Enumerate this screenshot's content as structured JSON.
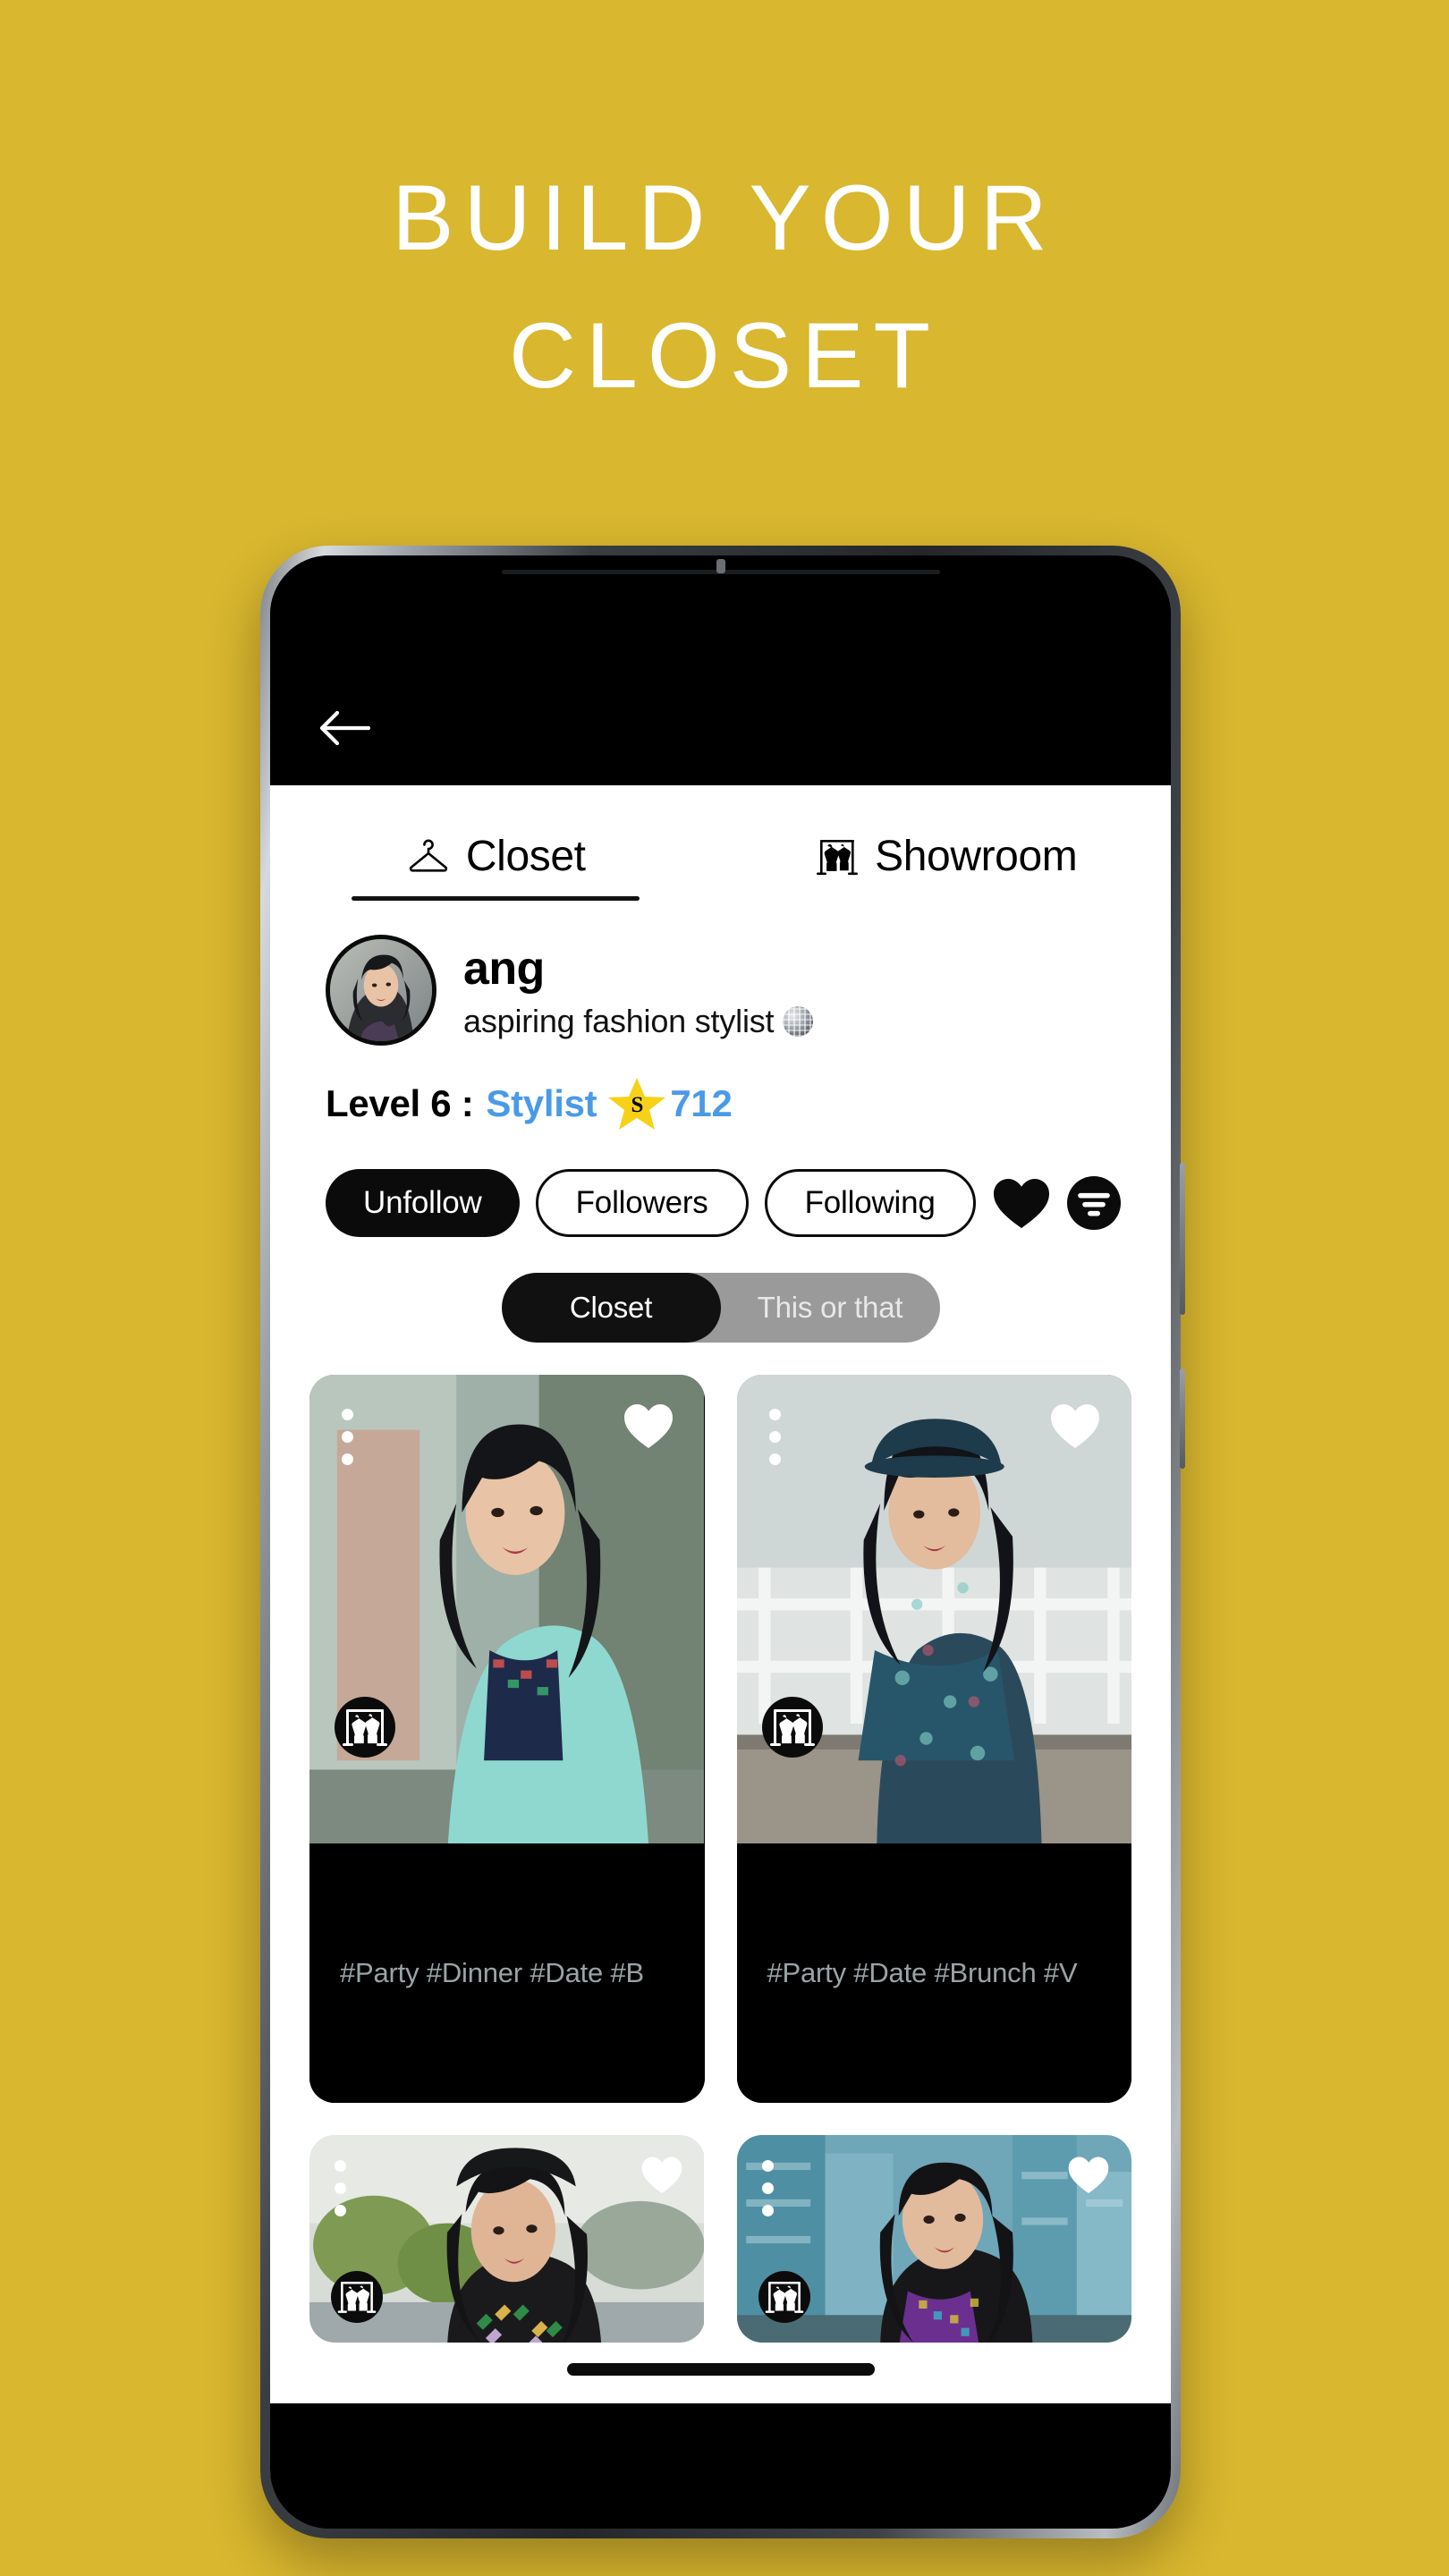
{
  "promo": {
    "headline_line1": "BUILD YOUR",
    "headline_line2": "CLOSET",
    "background_color": "#D9B72E",
    "text_color": "#FFFFFF"
  },
  "appbar": {
    "back_icon": "arrow-left-icon"
  },
  "tabs": [
    {
      "label": "Closet",
      "icon": "hanger-icon",
      "active": true
    },
    {
      "label": "Showroom",
      "icon": "clothing-rack-icon",
      "active": false
    }
  ],
  "profile": {
    "avatar": "user-avatar",
    "username": "ang",
    "bio": "aspiring fashion stylist",
    "bio_emoji": "disco-ball-emoji"
  },
  "level": {
    "prefix": "Level 6 :",
    "rank": "Stylist",
    "star_letter": "S",
    "points": "712",
    "rank_color": "#4A9AE8",
    "star_color": "#F7D117"
  },
  "actions": {
    "unfollow_label": "Unfollow",
    "followers_label": "Followers",
    "following_label": "Following",
    "heart_icon": "heart-filled-icon",
    "filter_icon": "filter-icon"
  },
  "segmented": {
    "option_closet": "Closet",
    "option_this_or_that": "This or that",
    "active": "Closet"
  },
  "cards": [
    {
      "photo": "outfit-mint-blazer",
      "hashtags": "#Party #Dinner #Date #B",
      "liked": true,
      "menu_icon": "more-options-icon",
      "showroom_icon": "clothing-rack-icon"
    },
    {
      "photo": "outfit-floral-dress",
      "hashtags": "#Party #Date #Brunch #V",
      "liked": true,
      "menu_icon": "more-options-icon",
      "showroom_icon": "clothing-rack-icon"
    },
    {
      "photo": "outfit-diamond-print-top",
      "liked": true,
      "menu_icon": "more-options-icon",
      "showroom_icon": "clothing-rack-icon"
    },
    {
      "photo": "outfit-purple-city",
      "liked": true,
      "menu_icon": "more-options-icon",
      "showroom_icon": "clothing-rack-icon"
    }
  ],
  "system": {
    "home_indicator": "home-indicator"
  }
}
